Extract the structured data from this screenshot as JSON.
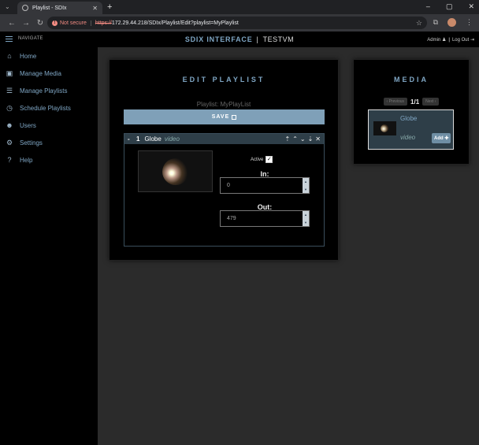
{
  "browser": {
    "tab_title": "Playlist - SDIx",
    "not_secure": "Not secure",
    "url_scheme": "https://",
    "url_rest": "172.29.44.218/SDIx/Playlist/Edit?playlist=MyPlaylist"
  },
  "app": {
    "navigate_label": "NAVIGATE",
    "title": "SDIX INTERFACE",
    "separator": "|",
    "server": "TESTVM",
    "user": "Admin",
    "user_sep": "|",
    "logout": "Log Out"
  },
  "sidebar": {
    "items": [
      {
        "label": "Home",
        "icon": "home-icon"
      },
      {
        "label": "Manage Media",
        "icon": "image-icon"
      },
      {
        "label": "Manage Playlists",
        "icon": "list-icon"
      },
      {
        "label": "Schedule Playlists",
        "icon": "clock-icon"
      },
      {
        "label": "Users",
        "icon": "users-icon"
      },
      {
        "label": "Settings",
        "icon": "gear-icon"
      },
      {
        "label": "Help",
        "icon": "help-icon"
      }
    ]
  },
  "edit": {
    "title": "EDIT PLAYLIST",
    "playlist_label": "Playlist: MyPlayList",
    "save_label": "SAVE",
    "item": {
      "collapse": "-",
      "index": "1",
      "name": "Globe",
      "type": "video",
      "active_label": "Active",
      "in_label": "In:",
      "in_value": "0",
      "out_label": "Out:",
      "out_value": "479"
    }
  },
  "media": {
    "title": "MEDIA",
    "prev_label": "Previous",
    "page": "1/1",
    "next_label": "Next",
    "card": {
      "name": "Globe",
      "type": "video",
      "add_label": "Add"
    }
  }
}
